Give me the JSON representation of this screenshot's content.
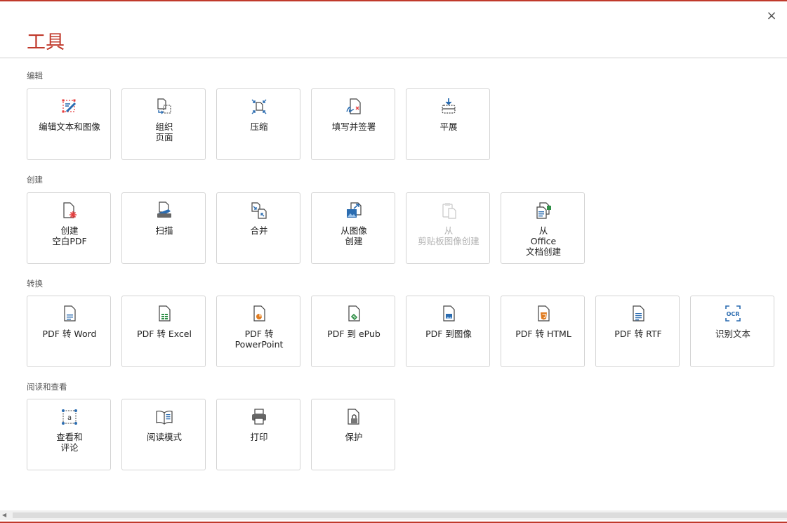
{
  "window": {
    "close_symbol": "×"
  },
  "header": {
    "title": "工具"
  },
  "sections": {
    "edit": {
      "label": "编辑",
      "tools": [
        {
          "label": "编辑文本和图像",
          "icon": "edit-text-image-icon"
        },
        {
          "label": "组织\n页面",
          "icon": "organize-pages-icon"
        },
        {
          "label": "压缩",
          "icon": "compress-icon"
        },
        {
          "label": "填写并签署",
          "icon": "fill-sign-icon"
        },
        {
          "label": "平展",
          "icon": "flatten-icon"
        }
      ]
    },
    "create": {
      "label": "创建",
      "tools": [
        {
          "label": "创建\n空白PDF",
          "icon": "create-blank-pdf-icon"
        },
        {
          "label": "扫描",
          "icon": "scan-icon"
        },
        {
          "label": "合并",
          "icon": "merge-icon"
        },
        {
          "label": "从图像\n创建",
          "icon": "create-from-image-icon"
        },
        {
          "label": "从\n剪贴板图像创建",
          "icon": "clipboard-icon",
          "disabled": true
        },
        {
          "label": "从\nOffice\n文档创建",
          "icon": "office-document-icon"
        }
      ]
    },
    "convert": {
      "label": "转换",
      "tools": [
        {
          "label": "PDF 转 Word",
          "icon": "word-doc-icon"
        },
        {
          "label": "PDF 转 Excel",
          "icon": "excel-doc-icon"
        },
        {
          "label": "PDF 转\nPowerPoint",
          "icon": "powerpoint-doc-icon"
        },
        {
          "label": "PDF 到 ePub",
          "icon": "epub-doc-icon"
        },
        {
          "label": "PDF 到图像",
          "icon": "image-doc-icon"
        },
        {
          "label": "PDF 转 HTML",
          "icon": "html-doc-icon"
        },
        {
          "label": "PDF 转 RTF",
          "icon": "rtf-doc-icon"
        },
        {
          "label": "识别文本",
          "icon": "ocr-icon"
        }
      ]
    },
    "read": {
      "label": "阅读和查看",
      "tools": [
        {
          "label": "查看和\n评论",
          "icon": "annotate-icon"
        },
        {
          "label": "阅读模式",
          "icon": "book-icon"
        },
        {
          "label": "打印",
          "icon": "printer-icon"
        },
        {
          "label": "保护",
          "icon": "lock-doc-icon"
        }
      ]
    }
  },
  "colors": {
    "accent": "#c0392b",
    "icon_blue": "#2b6cb0",
    "icon_gray": "#444444",
    "icon_red": "#e53e3e",
    "icon_green": "#2f8f46",
    "icon_orange": "#e07b1f"
  }
}
